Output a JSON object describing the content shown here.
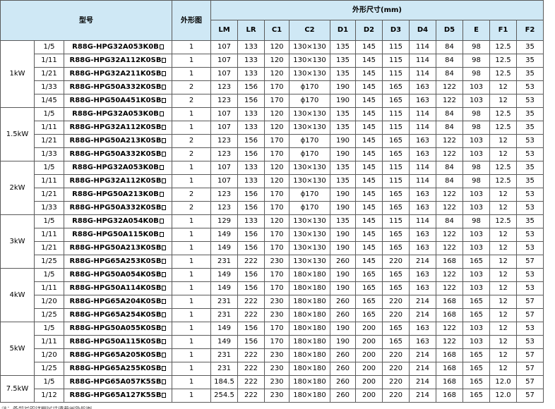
{
  "header": {
    "model": "型号",
    "outline": "外形图",
    "dims_group": "外形尺寸(mm)",
    "dims": [
      "LM",
      "LR",
      "C1",
      "C2",
      "D1",
      "D2",
      "D3",
      "D4",
      "D5",
      "E",
      "F1",
      "F2"
    ]
  },
  "groups": [
    {
      "power": "1kW",
      "rows": [
        {
          "ratio": "1/5",
          "model": "R88G-HPG32A053K0B",
          "fig": "1",
          "vals": [
            "107",
            "133",
            "120",
            "130×130",
            "135",
            "145",
            "115",
            "114",
            "84",
            "98",
            "12.5",
            "35"
          ]
        },
        {
          "ratio": "1/11",
          "model": "R88G-HPG32A112K0SB",
          "fig": "1",
          "vals": [
            "107",
            "133",
            "120",
            "130×130",
            "135",
            "145",
            "115",
            "114",
            "84",
            "98",
            "12.5",
            "35"
          ]
        },
        {
          "ratio": "1/21",
          "model": "R88G-HPG32A211K0SB",
          "fig": "1",
          "vals": [
            "107",
            "133",
            "120",
            "130×130",
            "135",
            "145",
            "115",
            "114",
            "84",
            "98",
            "12.5",
            "35"
          ]
        },
        {
          "ratio": "1/33",
          "model": "R88G-HPG50A332K0SB",
          "fig": "2",
          "vals": [
            "123",
            "156",
            "170",
            "ϕ170",
            "190",
            "145",
            "165",
            "163",
            "122",
            "103",
            "12",
            "53"
          ]
        },
        {
          "ratio": "1/45",
          "model": "R88G-HPG50A451K0SB",
          "fig": "2",
          "vals": [
            "123",
            "156",
            "170",
            "ϕ170",
            "190",
            "145",
            "165",
            "163",
            "122",
            "103",
            "12",
            "53"
          ]
        }
      ]
    },
    {
      "power": "1.5kW",
      "rows": [
        {
          "ratio": "1/5",
          "model": "R88G-HPG32A053K0B",
          "fig": "1",
          "vals": [
            "107",
            "133",
            "120",
            "130×130",
            "135",
            "145",
            "115",
            "114",
            "84",
            "98",
            "12.5",
            "35"
          ]
        },
        {
          "ratio": "1/11",
          "model": "R88G-HPG32A112K0SB",
          "fig": "1",
          "vals": [
            "107",
            "133",
            "120",
            "130×130",
            "135",
            "145",
            "115",
            "114",
            "84",
            "98",
            "12.5",
            "35"
          ]
        },
        {
          "ratio": "1/21",
          "model": "R88G-HPG50A213K0SB",
          "fig": "2",
          "vals": [
            "123",
            "156",
            "170",
            "ϕ170",
            "190",
            "145",
            "165",
            "163",
            "122",
            "103",
            "12",
            "53"
          ]
        },
        {
          "ratio": "1/33",
          "model": "R88G-HPG50A332K0SB",
          "fig": "2",
          "vals": [
            "123",
            "156",
            "170",
            "ϕ170",
            "190",
            "145",
            "165",
            "163",
            "122",
            "103",
            "12",
            "53"
          ]
        }
      ]
    },
    {
      "power": "2kW",
      "rows": [
        {
          "ratio": "1/5",
          "model": "R88G-HPG32A053K0B",
          "fig": "1",
          "vals": [
            "107",
            "133",
            "120",
            "130×130",
            "135",
            "145",
            "115",
            "114",
            "84",
            "98",
            "12.5",
            "35"
          ]
        },
        {
          "ratio": "1/11",
          "model": "R88G-HPG32A112K0SB",
          "fig": "1",
          "vals": [
            "107",
            "133",
            "120",
            "130×130",
            "135",
            "145",
            "115",
            "114",
            "84",
            "98",
            "12.5",
            "35"
          ]
        },
        {
          "ratio": "1/21",
          "model": "R88G-HPG50A213K0B",
          "fig": "2",
          "vals": [
            "123",
            "156",
            "170",
            "ϕ170",
            "190",
            "145",
            "165",
            "163",
            "122",
            "103",
            "12",
            "53"
          ]
        },
        {
          "ratio": "1/33",
          "model": "R88G-HPG50A332K0SB",
          "fig": "2",
          "vals": [
            "123",
            "156",
            "170",
            "ϕ170",
            "190",
            "145",
            "165",
            "163",
            "122",
            "103",
            "12",
            "53"
          ]
        }
      ]
    },
    {
      "power": "3kW",
      "rows": [
        {
          "ratio": "1/5",
          "model": "R88G-HPG32A054K0B",
          "fig": "1",
          "vals": [
            "129",
            "133",
            "120",
            "130×130",
            "135",
            "145",
            "115",
            "114",
            "84",
            "98",
            "12.5",
            "35"
          ]
        },
        {
          "ratio": "1/11",
          "model": "R88G-HPG50A115K0B",
          "fig": "1",
          "vals": [
            "149",
            "156",
            "170",
            "130×130",
            "190",
            "145",
            "165",
            "163",
            "122",
            "103",
            "12",
            "53"
          ]
        },
        {
          "ratio": "1/21",
          "model": "R88G-HPG50A213K0SB",
          "fig": "1",
          "vals": [
            "149",
            "156",
            "170",
            "130×130",
            "190",
            "145",
            "165",
            "163",
            "122",
            "103",
            "12",
            "53"
          ]
        },
        {
          "ratio": "1/25",
          "model": "R88G-HPG65A253K0SB",
          "fig": "1",
          "vals": [
            "231",
            "222",
            "230",
            "130×130",
            "260",
            "145",
            "220",
            "214",
            "168",
            "165",
            "12",
            "57"
          ]
        }
      ]
    },
    {
      "power": "4kW",
      "rows": [
        {
          "ratio": "1/5",
          "model": "R88G-HPG50A054K0SB",
          "fig": "1",
          "vals": [
            "149",
            "156",
            "170",
            "180×180",
            "190",
            "165",
            "165",
            "163",
            "122",
            "103",
            "12",
            "53"
          ]
        },
        {
          "ratio": "1/11",
          "model": "R88G-HPG50A114K0SB",
          "fig": "1",
          "vals": [
            "149",
            "156",
            "170",
            "180×180",
            "190",
            "165",
            "165",
            "163",
            "122",
            "103",
            "12",
            "53"
          ]
        },
        {
          "ratio": "1/20",
          "model": "R88G-HPG65A204K0SB",
          "fig": "1",
          "vals": [
            "231",
            "222",
            "230",
            "180×180",
            "260",
            "165",
            "220",
            "214",
            "168",
            "165",
            "12",
            "57"
          ]
        },
        {
          "ratio": "1/25",
          "model": "R88G-HPG65A254K0SB",
          "fig": "1",
          "vals": [
            "231",
            "222",
            "230",
            "180×180",
            "260",
            "165",
            "220",
            "214",
            "168",
            "165",
            "12",
            "57"
          ]
        }
      ]
    },
    {
      "power": "5kW",
      "rows": [
        {
          "ratio": "1/5",
          "model": "R88G-HPG50A055K0SB",
          "fig": "1",
          "vals": [
            "149",
            "156",
            "170",
            "180×180",
            "190",
            "200",
            "165",
            "163",
            "122",
            "103",
            "12",
            "53"
          ]
        },
        {
          "ratio": "1/11",
          "model": "R88G-HPG50A115K0SB",
          "fig": "1",
          "vals": [
            "149",
            "156",
            "170",
            "180×180",
            "190",
            "200",
            "165",
            "163",
            "122",
            "103",
            "12",
            "53"
          ]
        },
        {
          "ratio": "1/20",
          "model": "R88G-HPG65A205K0SB",
          "fig": "1",
          "vals": [
            "231",
            "222",
            "230",
            "180×180",
            "260",
            "200",
            "220",
            "214",
            "168",
            "165",
            "12",
            "57"
          ]
        },
        {
          "ratio": "1/25",
          "model": "R88G-HPG65A255K0SB",
          "fig": "1",
          "vals": [
            "231",
            "222",
            "230",
            "180×180",
            "260",
            "200",
            "220",
            "214",
            "168",
            "165",
            "12",
            "57"
          ]
        }
      ]
    },
    {
      "power": "7.5kW",
      "rows": [
        {
          "ratio": "1/5",
          "model": "R88G-HPG65A057K5SB",
          "fig": "1",
          "vals": [
            "184.5",
            "222",
            "230",
            "180×180",
            "260",
            "200",
            "220",
            "214",
            "168",
            "165",
            "12.0",
            "57"
          ]
        },
        {
          "ratio": "1/12",
          "model": "R88G-HPG65A127K5SB",
          "fig": "1",
          "vals": [
            "254.5",
            "222",
            "230",
            "180×180",
            "260",
            "200",
            "220",
            "214",
            "168",
            "165",
            "12.0",
            "57"
          ]
        }
      ]
    }
  ],
  "footnote": "注：各型号的详细尺寸请参阅外形图。"
}
